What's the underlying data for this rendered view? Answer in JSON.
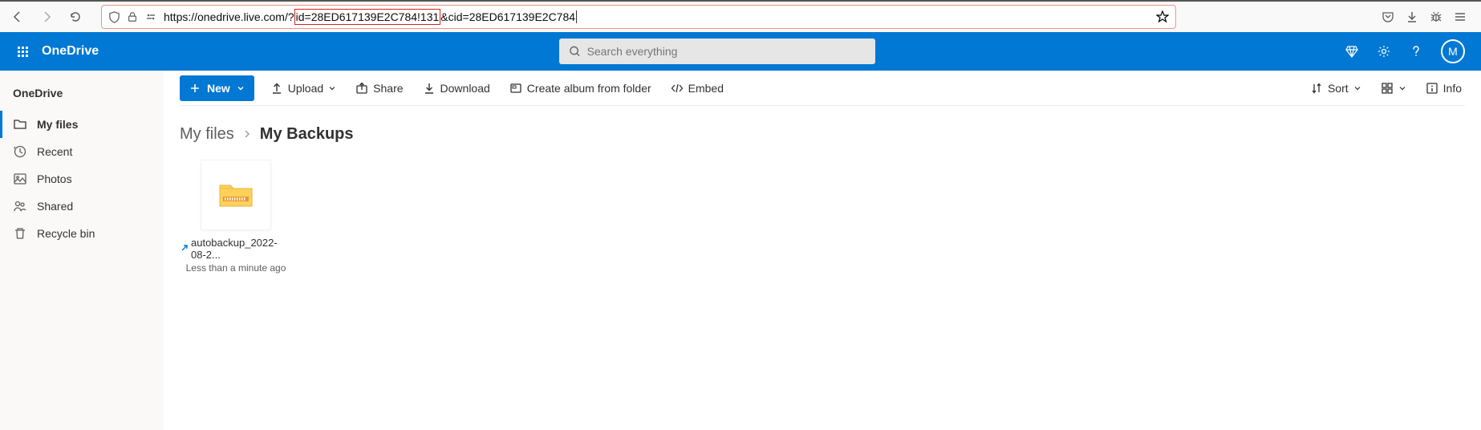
{
  "browser": {
    "url_pre": "https://onedrive.live.com/?",
    "url_highlight": "id=28ED617139E2C784!131",
    "url_post": "&cid=28ED617139E2C784"
  },
  "header": {
    "app_name": "OneDrive",
    "search_placeholder": "Search everything",
    "avatar_initial": "M"
  },
  "sidebar": {
    "title": "OneDrive",
    "items": [
      {
        "label": "My files"
      },
      {
        "label": "Recent"
      },
      {
        "label": "Photos"
      },
      {
        "label": "Shared"
      },
      {
        "label": "Recycle bin"
      }
    ]
  },
  "toolbar": {
    "new_label": "New",
    "upload_label": "Upload",
    "share_label": "Share",
    "download_label": "Download",
    "create_album_label": "Create album from folder",
    "embed_label": "Embed",
    "sort_label": "Sort",
    "info_label": "Info"
  },
  "breadcrumb": {
    "root": "My files",
    "current": "My Backups"
  },
  "files": [
    {
      "name": "autobackup_2022-08-2...",
      "subtitle": "Less than a minute ago"
    }
  ]
}
